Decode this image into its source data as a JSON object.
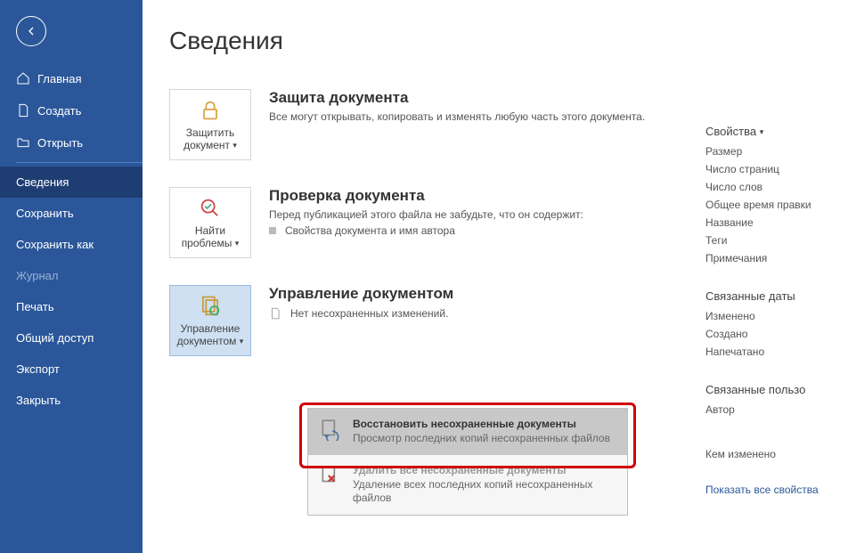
{
  "sidebar": {
    "items": [
      {
        "label": "Главная",
        "icon": "home"
      },
      {
        "label": "Создать",
        "icon": "new"
      },
      {
        "label": "Открыть",
        "icon": "open"
      },
      {
        "label": "Сведения",
        "selected": true
      },
      {
        "label": "Сохранить"
      },
      {
        "label": "Сохранить как"
      },
      {
        "label": "Журнал",
        "disabled": true
      },
      {
        "label": "Печать"
      },
      {
        "label": "Общий доступ"
      },
      {
        "label": "Экспорт"
      },
      {
        "label": "Закрыть"
      }
    ]
  },
  "page": {
    "title": "Сведения"
  },
  "sections": {
    "protect": {
      "button": "Защитить документ",
      "heading": "Защита документа",
      "desc": "Все могут открывать, копировать и изменять любую часть этого документа."
    },
    "inspect": {
      "button": "Найти проблемы",
      "heading": "Проверка документа",
      "desc": "Перед публикацией этого файла не забудьте, что он содержит:",
      "bullet": "Свойства документа и имя автора"
    },
    "manage": {
      "button": "Управление документом",
      "heading": "Управление документом",
      "row": "Нет несохраненных изменений."
    }
  },
  "dropdown": {
    "recover": {
      "title": "Восстановить несохраненные документы",
      "desc": "Просмотр последних копий несохраненных файлов"
    },
    "delete": {
      "title": "Удалить все несохраненные документы",
      "desc": "Удаление всех последних копий несохраненных файлов"
    }
  },
  "props": {
    "heading": "Свойства",
    "size": "Размер",
    "pages": "Число страниц",
    "words": "Число слов",
    "edit_time": "Общее время правки",
    "title": "Название",
    "tags": "Теги",
    "comments": "Примечания",
    "dates_heading": "Связанные даты",
    "modified": "Изменено",
    "created": "Создано",
    "printed": "Напечатано",
    "people_heading": "Связанные пользо",
    "author": "Автор",
    "last_modified_by": "Кем изменено",
    "link": "Показать все свойства"
  }
}
